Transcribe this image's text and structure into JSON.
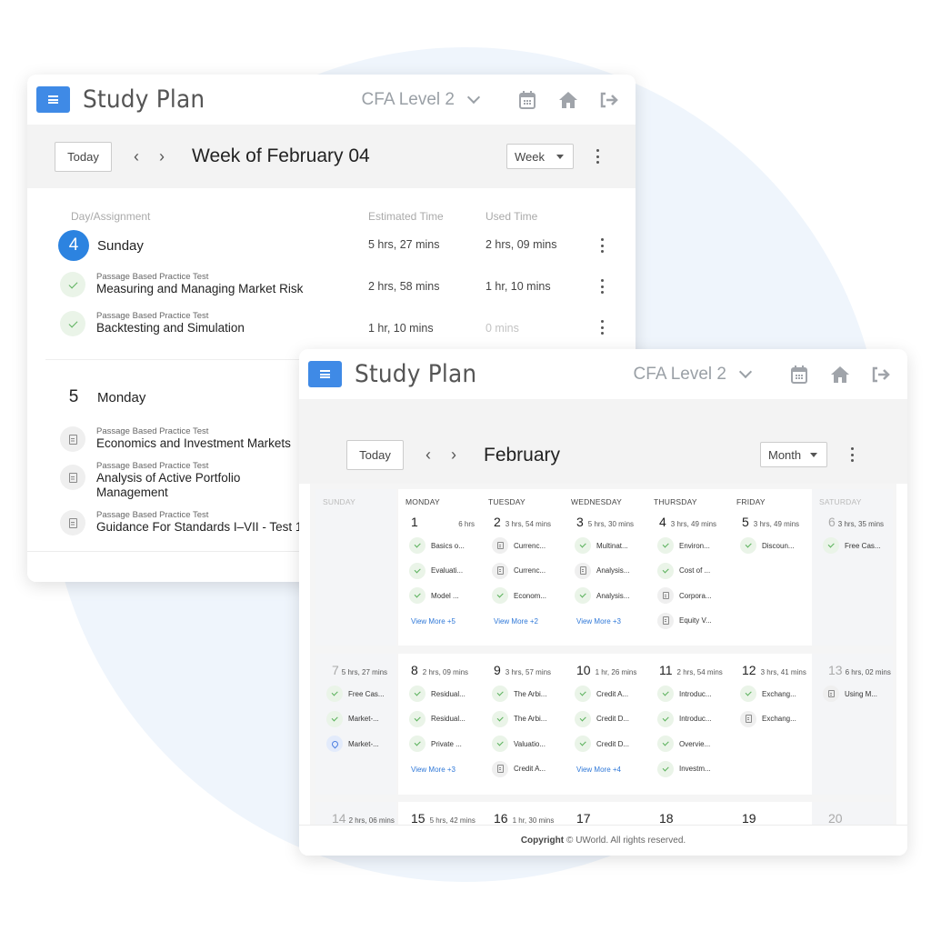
{
  "app": {
    "title": "Study Plan",
    "level": "CFA Level 2",
    "icons": [
      "menu-icon",
      "calendar-icon",
      "home-icon",
      "logout-icon"
    ]
  },
  "week_view": {
    "today_label": "Today",
    "prev_label": "‹",
    "next_label": "›",
    "period": "Week of February 04",
    "view_option": "Week",
    "columns": {
      "assignment": "Day/Assignment",
      "estimated": "Estimated Time",
      "used": "Used Time"
    },
    "days": [
      {
        "number": "4",
        "name": "Sunday",
        "estimated": "5 hrs, 27 mins",
        "used": "2 hrs, 09 mins",
        "assignments": [
          {
            "type": "Passage Based Practice Test",
            "name": "Measuring and Managing Market Risk",
            "status": "done",
            "estimated": "2 hrs, 58 mins",
            "used": "1 hr, 10 mins"
          },
          {
            "type": "Passage Based Practice Test",
            "name": "Backtesting and Simulation",
            "status": "done",
            "estimated": "1 hr, 10 mins",
            "used": "0 mins"
          }
        ]
      },
      {
        "number": "5",
        "name": "Monday",
        "assignments": [
          {
            "type": "Passage Based Practice Test",
            "name": "Economics and Investment Markets",
            "status": "pending"
          },
          {
            "type": "Passage Based Practice Test",
            "name": "Analysis of Active Portfolio Management",
            "status": "pending"
          },
          {
            "type": "Passage Based Practice Test",
            "name": "Guidance For Standards I–VII - Test 1",
            "status": "pending"
          }
        ]
      }
    ],
    "footer_bold": "Copyright ©"
  },
  "month_view": {
    "today_label": "Today",
    "prev_label": "‹",
    "next_label": "›",
    "period": "February",
    "view_option": "Month",
    "weekdays": [
      "SUNDAY",
      "MONDAY",
      "TUESDAY",
      "WEDNESDAY",
      "THURSDAY",
      "FRIDAY",
      "SATURDAY"
    ],
    "weeks": [
      [
        {
          "day": "",
          "hours": "",
          "events": []
        },
        {
          "day": "1",
          "hours": "6 hrs",
          "events": [
            {
              "label": "Basics o...",
              "status": "done"
            },
            {
              "label": "Evaluati...",
              "status": "done"
            },
            {
              "label": "Model ...",
              "status": "done"
            }
          ],
          "more": "View More +5"
        },
        {
          "day": "2",
          "hours": "3 hrs, 54 mins",
          "events": [
            {
              "label": "Currenc...",
              "status": "doc"
            },
            {
              "label": "Currenc...",
              "status": "doc"
            },
            {
              "label": "Econom...",
              "status": "done"
            }
          ],
          "more": "View More +2"
        },
        {
          "day": "3",
          "hours": "5 hrs, 30 mins",
          "events": [
            {
              "label": "Multinat...",
              "status": "done"
            },
            {
              "label": "Analysis...",
              "status": "doc"
            },
            {
              "label": "Analysis...",
              "status": "done"
            }
          ],
          "more": "View More +3"
        },
        {
          "day": "4",
          "hours": "3 hrs, 49 mins",
          "events": [
            {
              "label": "Environ...",
              "status": "done"
            },
            {
              "label": "Cost of ...",
              "status": "done"
            },
            {
              "label": "Corpora...",
              "status": "doc"
            },
            {
              "label": "Equity V...",
              "status": "doc"
            }
          ]
        },
        {
          "day": "5",
          "hours": "3 hrs, 49 mins",
          "events": [
            {
              "label": "Discoun...",
              "status": "done"
            }
          ]
        },
        {
          "day": "6",
          "hours": "3 hrs, 35 mins",
          "events": [
            {
              "label": "Free Cas...",
              "status": "done"
            }
          ]
        }
      ],
      [
        {
          "day": "7",
          "hours": "5 hrs, 27 mins",
          "events": [
            {
              "label": "Free Cas...",
              "status": "done"
            },
            {
              "label": "Market-...",
              "status": "done"
            },
            {
              "label": "Market-...",
              "status": "pin"
            }
          ]
        },
        {
          "day": "8",
          "hours": "2 hrs, 09 mins",
          "events": [
            {
              "label": "Residual...",
              "status": "done"
            },
            {
              "label": "Residual...",
              "status": "done"
            },
            {
              "label": "Private ...",
              "status": "done"
            }
          ],
          "more": "View More +3"
        },
        {
          "day": "9",
          "hours": "3 hrs, 57 mins",
          "events": [
            {
              "label": "The Arbi...",
              "status": "done"
            },
            {
              "label": "The Arbi...",
              "status": "done"
            },
            {
              "label": "Valuatio...",
              "status": "done"
            },
            {
              "label": "Credit A...",
              "status": "doc"
            }
          ]
        },
        {
          "day": "10",
          "hours": "1 hr, 26 mins",
          "events": [
            {
              "label": "Credit A...",
              "status": "done"
            },
            {
              "label": "Credit D...",
              "status": "done"
            },
            {
              "label": "Credit D...",
              "status": "done"
            }
          ],
          "more": "View More +4"
        },
        {
          "day": "11",
          "hours": "2 hrs, 54 mins",
          "events": [
            {
              "label": "Introduc...",
              "status": "done"
            },
            {
              "label": "Introduc...",
              "status": "done"
            },
            {
              "label": "Overvie...",
              "status": "done"
            },
            {
              "label": "Investm...",
              "status": "done"
            }
          ]
        },
        {
          "day": "12",
          "hours": "3 hrs, 41 mins",
          "events": [
            {
              "label": "Exchang...",
              "status": "done"
            },
            {
              "label": "Exchang...",
              "status": "doc"
            }
          ]
        },
        {
          "day": "13",
          "hours": "6 hrs, 02 mins",
          "events": [
            {
              "label": "Using M...",
              "status": "doc"
            }
          ]
        }
      ],
      [
        {
          "day": "14",
          "hours": "2 hrs, 06 mins",
          "events": []
        },
        {
          "day": "15",
          "hours": "5 hrs, 42 mins",
          "events": []
        },
        {
          "day": "16",
          "hours": "1 hr, 30 mins",
          "events": []
        },
        {
          "day": "17",
          "hours": "",
          "events": []
        },
        {
          "day": "18",
          "hours": "",
          "events": []
        },
        {
          "day": "19",
          "hours": "",
          "events": []
        },
        {
          "day": "20",
          "hours": "",
          "events": []
        }
      ]
    ],
    "footer_bold": "Copyright",
    "footer_text": "© UWorld. All rights reserved."
  },
  "colors": {
    "accent": "#2c83e0",
    "menu_button": "#3f8ae6",
    "done": "#5bb15c",
    "link": "#2f78d8",
    "background_circle": "#eff5fc"
  }
}
